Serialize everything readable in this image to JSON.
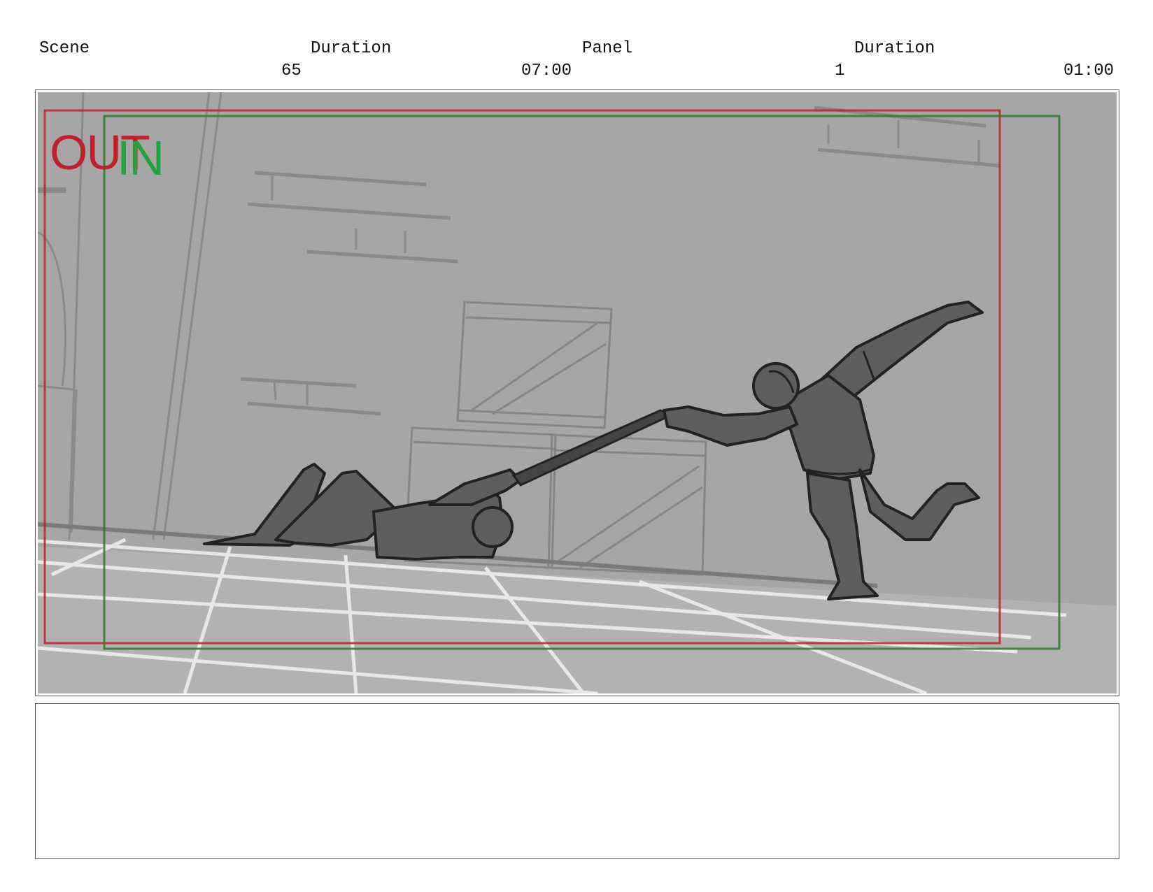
{
  "header": {
    "scene_label": "Scene",
    "scene_duration_label": "Duration",
    "panel_label": "Panel",
    "panel_duration_label": "Duration",
    "scene_value": "65",
    "scene_duration_value": "07:00",
    "panel_value": "1",
    "panel_duration_value": "01:00"
  },
  "panel": {
    "out_label": "OUT",
    "in_label": "IN",
    "out_color": "#c0202a",
    "in_color": "#22a33a",
    "background_color": "#a6a6a6"
  },
  "notes": {
    "text": ""
  }
}
